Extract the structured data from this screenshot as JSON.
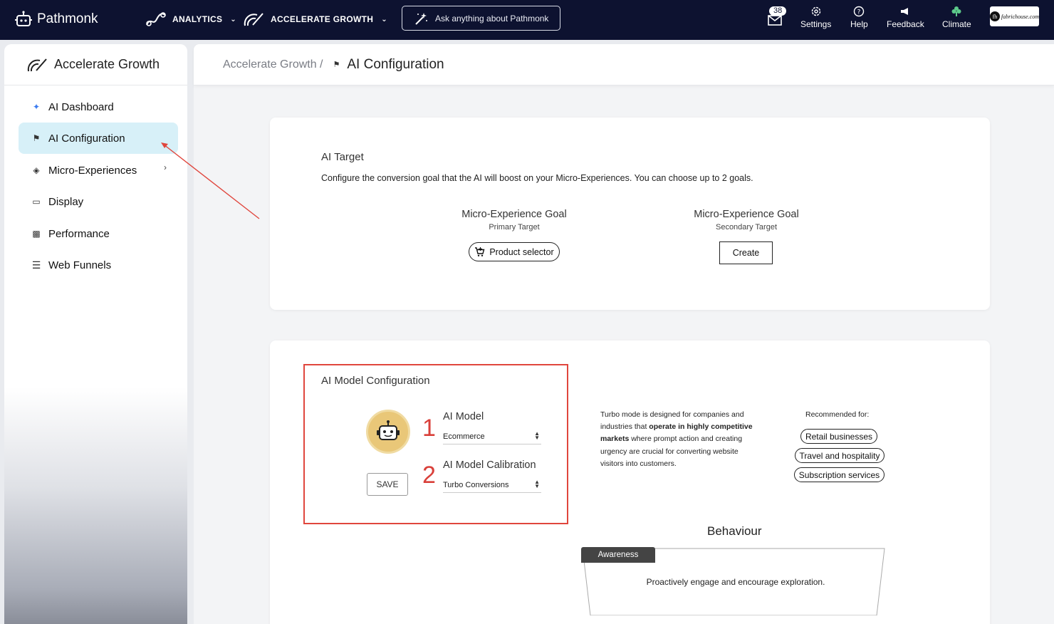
{
  "topbar": {
    "brand": "Pathmonk",
    "nav": [
      {
        "label": "ANALYTICS",
        "icon": "analytics-icon"
      },
      {
        "label": "ACCELERATE GROWTH",
        "icon": "accelerate-growth-icon"
      }
    ],
    "ask_placeholder": "Ask anything about Pathmonk",
    "mail_count": "38",
    "tools": [
      {
        "label": "Settings",
        "icon": "gear-icon"
      },
      {
        "label": "Help",
        "icon": "help-icon"
      },
      {
        "label": "Feedback",
        "icon": "megaphone-icon"
      },
      {
        "label": "Climate",
        "icon": "plant-icon"
      }
    ],
    "account_logo_text": "fabrichouse.com",
    "account_logo_initial": "fh"
  },
  "sidebar": {
    "title": "Accelerate Growth",
    "items": [
      {
        "label": "AI Dashboard",
        "icon": "sparkle-icon"
      },
      {
        "label": "AI Configuration",
        "icon": "flag-icon",
        "active": true
      },
      {
        "label": "Micro-Experiences",
        "icon": "layers-icon",
        "has_caret": true
      },
      {
        "label": "Display",
        "icon": "display-icon"
      },
      {
        "label": "Performance",
        "icon": "bar-chart-icon"
      },
      {
        "label": "Web Funnels",
        "icon": "list-icon"
      }
    ]
  },
  "breadcrumb": {
    "parent": "Accelerate Growth /",
    "current": "AI Configuration"
  },
  "ai_target": {
    "title": "AI Target",
    "description": "Configure the conversion goal that the AI will boost on your Micro-Experiences. You can choose up to 2 goals.",
    "primary": {
      "title": "Micro-Experience Goal",
      "subtitle": "Primary Target",
      "button": "Product selector"
    },
    "secondary": {
      "title": "Micro-Experience Goal",
      "subtitle": "Secondary Target",
      "button": "Create"
    }
  },
  "ai_model": {
    "title": "AI Model Configuration",
    "model_label": "AI Model",
    "model_value": "Ecommerce",
    "calibration_label": "AI Model Calibration",
    "calibration_value": "Turbo Conversions",
    "save_label": "SAVE",
    "annotations": [
      "1",
      "2"
    ],
    "turbo_text_1": "Turbo mode is designed for companies and industries that ",
    "turbo_bold_1": "operate in highly competitive markets",
    "turbo_text_2": " where prompt action and creating urgency are crucial for converting website visitors into customers.",
    "recommended_title": "Recommended for:",
    "recommended": [
      "Retail businesses",
      "Travel and hospitality",
      "Subscription services"
    ]
  },
  "behaviour": {
    "title": "Behaviour",
    "tag": "Awareness",
    "text": "Proactively engage and encourage exploration."
  },
  "colors": {
    "topbar_bg": "#0d1230",
    "active_item_bg": "#d7f0f8",
    "annotation_red": "#e0463d"
  }
}
